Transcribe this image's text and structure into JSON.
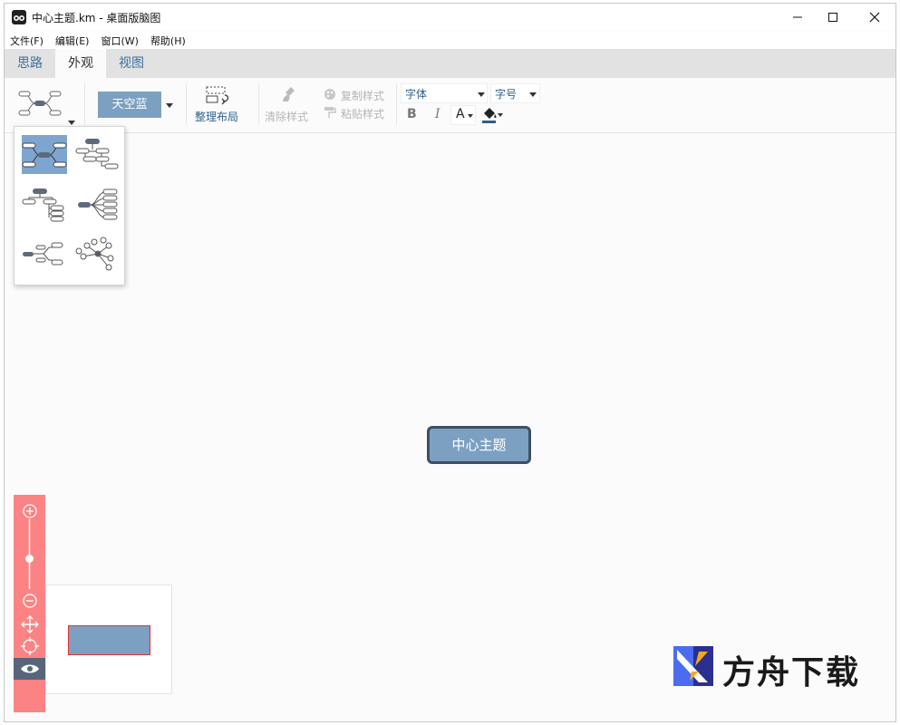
{
  "window": {
    "title": "中心主题.km - 桌面版脑图"
  },
  "menu": [
    "文件(F)",
    "编辑(E)",
    "窗口(W)",
    "帮助(H)"
  ],
  "tabs": [
    {
      "label": "思路",
      "active": false
    },
    {
      "label": "外观",
      "active": true
    },
    {
      "label": "视图",
      "active": false
    }
  ],
  "toolbar": {
    "theme_label": "天空蓝",
    "arrange_label": "整理布局",
    "clear_style_label": "清除样式",
    "copy_style_label": "复制样式",
    "paste_style_label": "粘贴样式",
    "font_family_placeholder": "字体",
    "font_size_placeholder": "字号",
    "bold_label": "B",
    "italic_label": "I",
    "font_color_label": "A"
  },
  "canvas": {
    "root_topic": "中心主题"
  },
  "watermark": {
    "text": "方舟下载"
  },
  "colors": {
    "accent": "#7ca0c2",
    "node_border": "#3f4f61",
    "zoom_panel": "#fc8383",
    "tab_text": "#3b6fa0"
  }
}
